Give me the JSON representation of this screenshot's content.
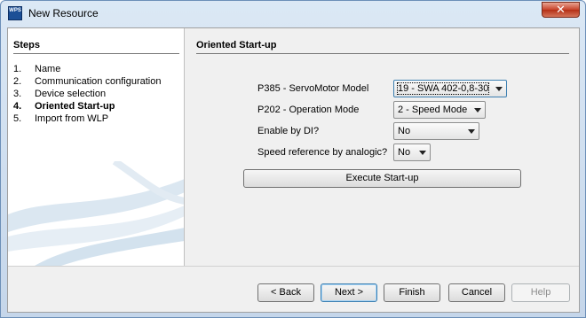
{
  "window": {
    "title": "New Resource",
    "icon_text": "WPS",
    "close_glyph": "✕"
  },
  "steps": {
    "title": "Steps",
    "items": [
      {
        "num": "1.",
        "label": "Name"
      },
      {
        "num": "2.",
        "label": "Communication configuration"
      },
      {
        "num": "3.",
        "label": "Device selection"
      },
      {
        "num": "4.",
        "label": "Oriented Start-up",
        "active": true
      },
      {
        "num": "5.",
        "label": "Import from WLP"
      }
    ]
  },
  "content": {
    "title": "Oriented Start-up",
    "fields": {
      "servo_model": {
        "label": "P385 - ServoMotor Model",
        "value": "19 - SWA 402-0,8-30"
      },
      "operation_mode": {
        "label": "P202 - Operation Mode",
        "value": "2 - Speed Mode"
      },
      "enable_by_di": {
        "label": "Enable by DI?",
        "value": "No"
      },
      "speed_ref_analogic": {
        "label": "Speed reference by analogic?",
        "value": "No"
      }
    },
    "execute_label": "Execute Start-up"
  },
  "buttons": {
    "back": "< Back",
    "next": "Next >",
    "finish": "Finish",
    "cancel": "Cancel",
    "help": "Help"
  },
  "colors": {
    "accent_border": "#3c7fb1",
    "close_red": "#c7432a",
    "title_bar": "#dbe8f5"
  }
}
